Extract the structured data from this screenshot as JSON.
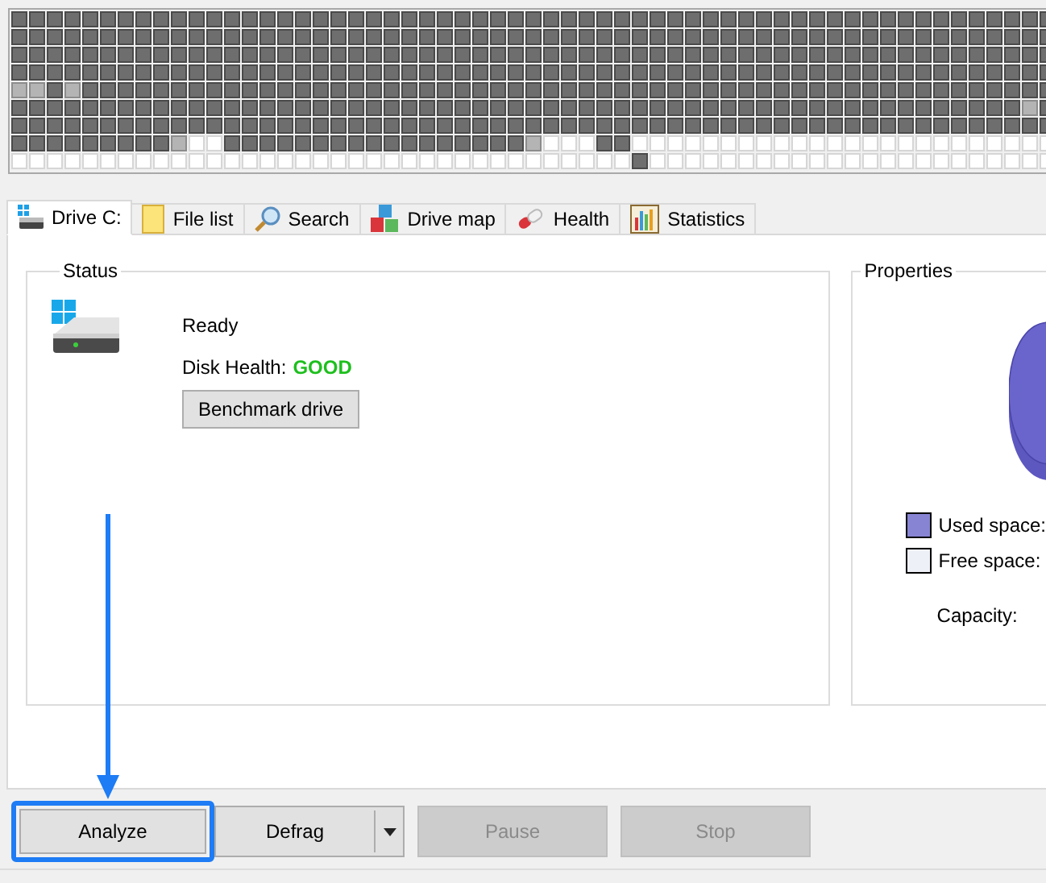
{
  "tabs": [
    {
      "label": "Drive C:",
      "selected": true,
      "kind": "drive"
    },
    {
      "label": "File list",
      "selected": false,
      "kind": "folder"
    },
    {
      "label": "Search",
      "selected": false,
      "kind": "search"
    },
    {
      "label": "Drive map",
      "selected": false,
      "kind": "map"
    },
    {
      "label": "Health",
      "selected": false,
      "kind": "health"
    },
    {
      "label": "Statistics",
      "selected": false,
      "kind": "stats"
    }
  ],
  "status": {
    "title": "Status",
    "state": "Ready",
    "health_label": "Disk Health:",
    "health_value": "GOOD",
    "benchmark_button": "Benchmark drive"
  },
  "properties": {
    "title": "Properties",
    "legend": [
      {
        "label": "Used space:",
        "color": "#8884d4"
      },
      {
        "label": "Free space:",
        "color": "#eef0f8"
      }
    ],
    "capacity_label": "Capacity:"
  },
  "buttons": [
    {
      "label": "Analyze",
      "disabled": false,
      "highlighted": true,
      "kind": "button"
    },
    {
      "label": "Defrag",
      "disabled": false,
      "highlighted": false,
      "kind": "split"
    },
    {
      "label": "Pause",
      "disabled": true,
      "highlighted": false,
      "kind": "button"
    },
    {
      "label": "Stop",
      "disabled": true,
      "highlighted": false,
      "kind": "button"
    }
  ]
}
